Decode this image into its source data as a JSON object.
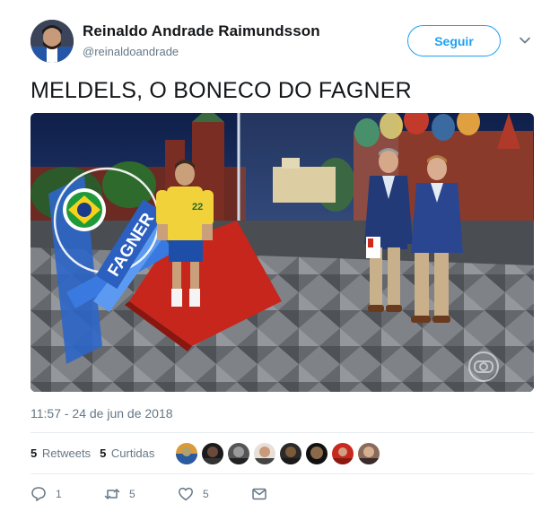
{
  "author": {
    "name": "Reinaldo Andrade Raimundsson",
    "handle": "@reinaldoandrade"
  },
  "follow_label": "Seguir",
  "tweet_text": "MELDELS, O BONECO DO FAGNER",
  "media": {
    "overlay_name": "FAGNER",
    "jersey_number": "22"
  },
  "timestamp": "11:57 - 24 de jun de 2018",
  "stats": {
    "retweets_count": "5",
    "retweets_label": "Retweets",
    "likes_count": "5",
    "likes_label": "Curtidas"
  },
  "actions": {
    "reply_count": "1",
    "retweet_count": "5",
    "like_count": "5"
  },
  "colors": {
    "brand_blue": "#1da1f2",
    "secondary_text": "#657786",
    "primary_text": "#14171a"
  }
}
